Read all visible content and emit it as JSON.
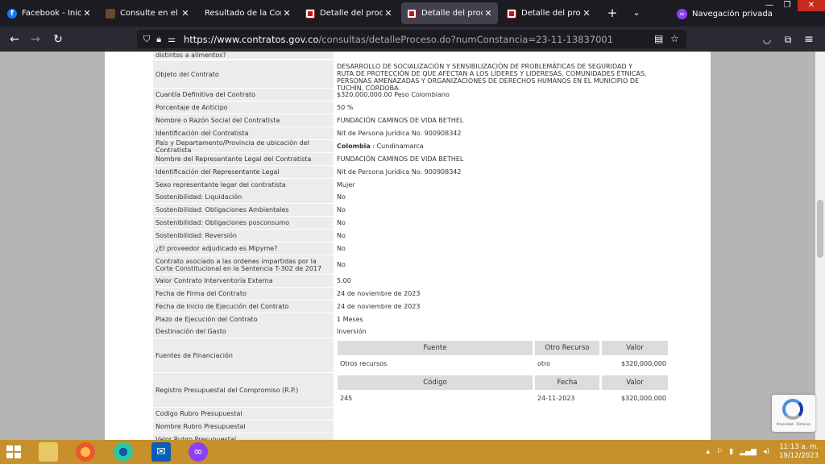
{
  "browser": {
    "tabs": [
      {
        "title": "Facebook - Inicia ses",
        "favicon": "facebook-icon",
        "active": false
      },
      {
        "title": "Consulte en el SECOP",
        "favicon": "secop-icon",
        "active": false
      },
      {
        "title": "Resultado de la Consulta",
        "favicon": "none",
        "active": false
      },
      {
        "title": "Detalle del proceso",
        "favicon": "colombia-compra-icon",
        "active": false
      },
      {
        "title": "Detalle del proceso",
        "favicon": "colombia-compra-icon",
        "active": true
      },
      {
        "title": "Detalle del proceso",
        "favicon": "colombia-compra-icon",
        "active": false
      }
    ],
    "private_label": "Navegación privada",
    "url_host": "https://www.contratos.gov.co",
    "url_path": "/consultas/detalleProceso.do?numConstancia=23-11-13837001"
  },
  "details": {
    "top_cut": "distintos a alimentos?",
    "rows": [
      {
        "label": "Objeto del Contrato",
        "value": "DESARROLLO DE SOCIALIZACIÓN Y SENSIBILIZACIÓN DE PROBLEMÁTICAS DE SEGURIDAD Y RUTA DE PROTECCIÓN DE QUE AFECTAN A LOS LÍDERES Y LIDERESAS, COMUNIDADES ÉTNICAS, PERSONAS AMENAZADAS Y ORGANIZACIONES DE DERECHOS HUMANOS EN EL MUNICIPIO DE TUCHÍN, CÓRDOBA"
      },
      {
        "label": "Cuantía Definitiva del Contrato",
        "value": "$320,000,000.00 Peso Colombiano"
      },
      {
        "label": "Porcentaje de Anticipo",
        "value": "50 %"
      },
      {
        "label": "Nombre o Razón Social del Contratista",
        "value": "FUNDACIÓN CAMINOS DE VIDA BETHEL"
      },
      {
        "label": "Identificación del Contratista",
        "value": "Nit de Persona Jurídica No. 900908342"
      },
      {
        "label": "País y Departamento/Provincia de ubicación del Contratista",
        "value_bold": "Colombia",
        "value": " : Cundinamarca"
      },
      {
        "label": "Nombre del Representante Legal del Contratista",
        "value": "FUNDACIÓN CAMINOS DE VIDA BETHEL"
      },
      {
        "label": "Identificación del Representante Legal",
        "value": "Nit de Persona Jurídica No. 900908342"
      },
      {
        "label": "Sexo representante legar del contratista",
        "value": "Mujer"
      },
      {
        "label": "Sostenibilidad: Liquidación",
        "value": "No"
      },
      {
        "label": "Sostenibilidad: Obligaciones Ambientales",
        "value": "No"
      },
      {
        "label": "Sostenibilidad: Obligaciones posconsumo",
        "value": "No"
      },
      {
        "label": "Sostenibilidad: Reversión",
        "value": "No"
      },
      {
        "label": "¿El proveedor adjudicado es Mipyme?",
        "value": "No"
      },
      {
        "label": "Contrato asociado a las ordenes impartidas por la Corte Constitucional en la Sentencia T-302 de 2017",
        "value": "No"
      },
      {
        "label": "Valor Contrato Interventoría Externa",
        "value": "5.00"
      },
      {
        "label": "Fecha de Firma del Contrato",
        "value": "24 de noviembre de 2023"
      },
      {
        "label": "Fecha de Inicio de Ejecución del Contrato",
        "value": "24 de noviembre de 2023"
      },
      {
        "label": "Plazo de Ejecución del Contrato",
        "value": "1 Meses"
      },
      {
        "label": "Destinación del Gasto",
        "value": "Inversión"
      }
    ],
    "fuentes": {
      "label": "Fuentes de Financiación",
      "headers": [
        "Fuente",
        "Otro Recurso",
        "Valor"
      ],
      "row": [
        "Otros recursos",
        "otro",
        "$320,000,000"
      ]
    },
    "registro": {
      "label": "Registro Presupuestal del Compromiso (R.P.)",
      "headers": [
        "Código",
        "Fecha",
        "Valor"
      ],
      "row": [
        "245",
        "24-11-2023",
        "$320,000,000"
      ]
    },
    "bottom_rows": [
      {
        "label": "Codigo Rubro Presupuestal"
      },
      {
        "label": "Nombre Rubro Presupuestal"
      },
      {
        "label": "Valor Rubro Presupuestal"
      }
    ]
  },
  "recaptcha_text": "Privacidad - Términos",
  "taskbar": {
    "time": "11:13 a. m.",
    "date": "19/12/2023"
  }
}
